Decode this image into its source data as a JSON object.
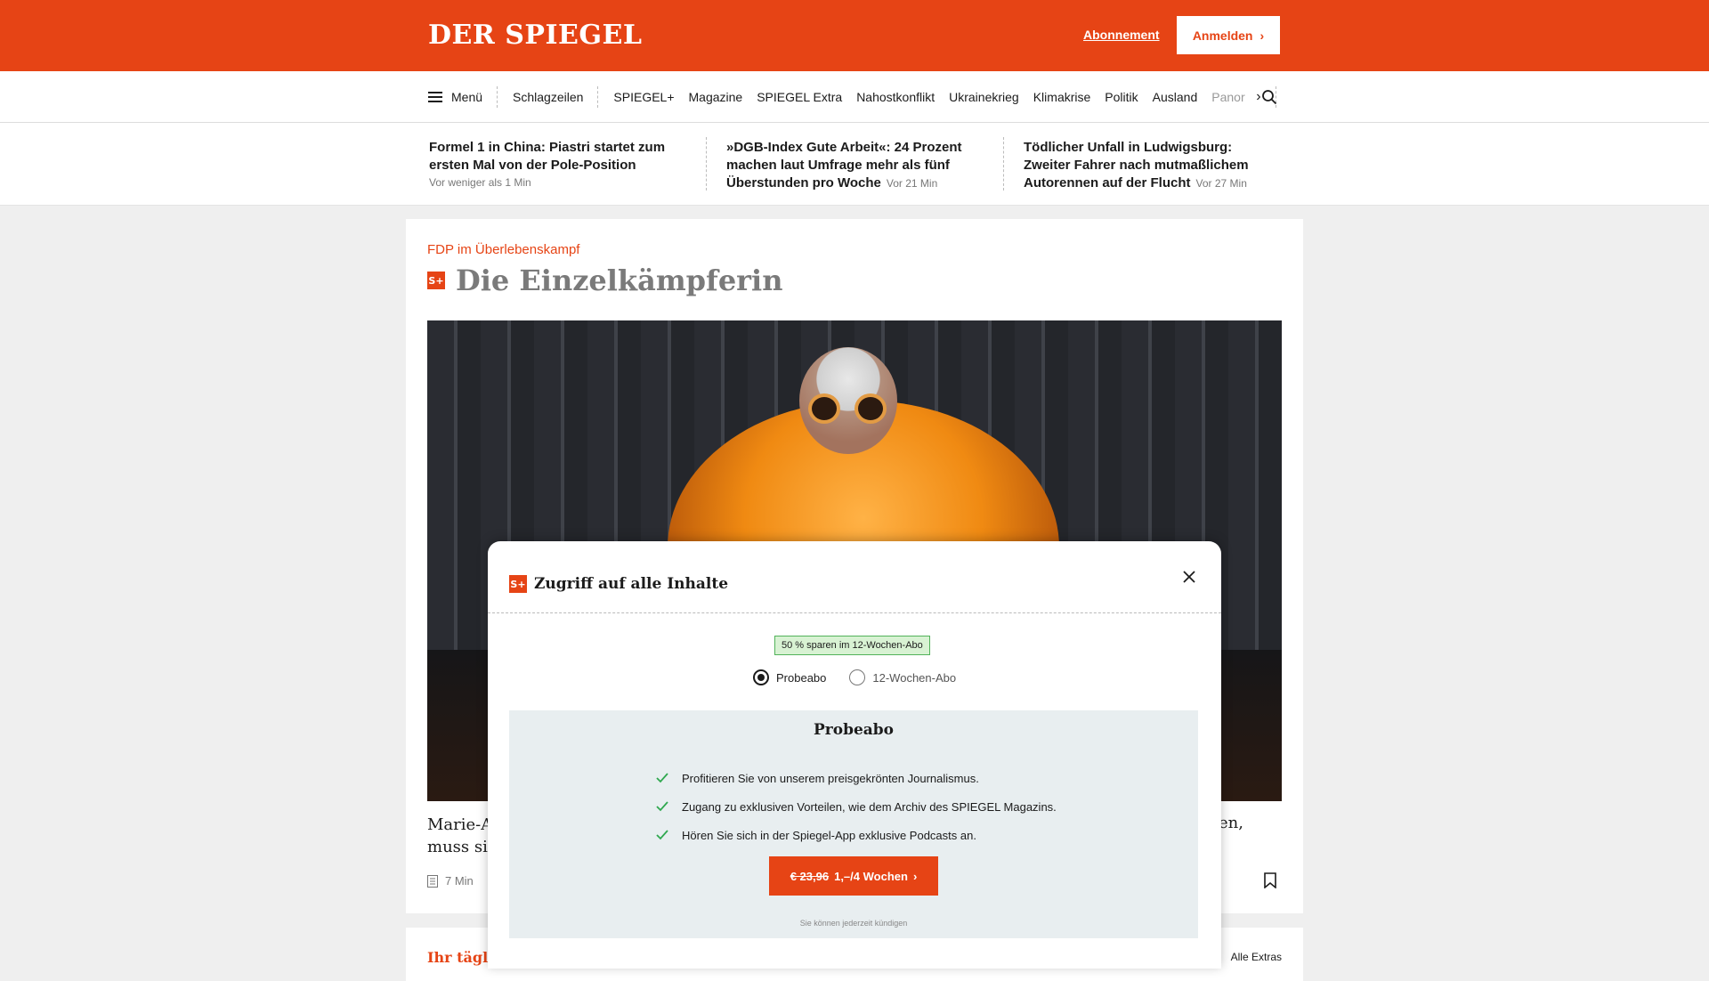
{
  "header": {
    "logo": "DER SPIEGEL",
    "subscription_link": "Abonnement",
    "login_button": "Anmelden"
  },
  "nav": {
    "menu_label": "Menü",
    "items": [
      "Schlagzeilen",
      "SPIEGEL+",
      "Magazine",
      "SPIEGEL Extra",
      "Nahostkonflikt",
      "Ukrainekrieg",
      "Klimakrise",
      "Politik",
      "Ausland",
      "Panorama"
    ],
    "icons": [
      "hamburger-icon",
      "chevron-right-icon",
      "search-icon"
    ]
  },
  "headlines": [
    {
      "title": "Formel 1 in China: Piastri startet zum ersten Mal von der Pole-Position",
      "time": "Vor weniger als 1 Min"
    },
    {
      "title": "»DGB-Index Gute Arbeit«: 24 Prozent machen laut Umfrage mehr als fünf Überstunden pro Woche",
      "time": "Vor 21 Min"
    },
    {
      "title": "Tödlicher Unfall in Ludwigsburg: Zweiter Fahrer nach mutmaßlichem Autorennen auf der Flucht",
      "time": "Vor 27 Min"
    }
  ],
  "article": {
    "kicker": "FDP im Überlebenskampf",
    "badge": "S+",
    "title": "Die Einzelkämpferin",
    "caption_line1": "Marie-Ag",
    "caption_line2": "muss sich",
    "caption_right": "lten,",
    "read_time": "7 Min"
  },
  "next_section": {
    "title_partial": "Ihr täglic",
    "link": "Alle Extras"
  },
  "modal": {
    "badge": "S+",
    "title": "Zugriff auf alle Inhalte",
    "save_badge": "50 % sparen im 12-Wochen-Abo",
    "options": [
      {
        "label": "Probeabo",
        "checked": true
      },
      {
        "label": "12-Wochen-Abo",
        "checked": false
      }
    ],
    "offer_title": "Probeabo",
    "benefits": [
      "Profitieren Sie von unserem preisgekrönten Journalismus.",
      "Zugang zu exklusiven Vorteilen, wie dem Archiv des SPIEGEL Magazins.",
      "Hören Sie sich in der Spiegel-App exklusive Podcasts an."
    ],
    "cta_old_price": "€ 23,96",
    "cta_new_price": "1,–/4 Wochen",
    "cancel_note": "Sie können jederzeit kündigen"
  },
  "colors": {
    "brand": "#e64415",
    "badge_green": "#d8f2d3",
    "check_green": "#2fa84f",
    "offer_bg": "#e8eef0"
  }
}
